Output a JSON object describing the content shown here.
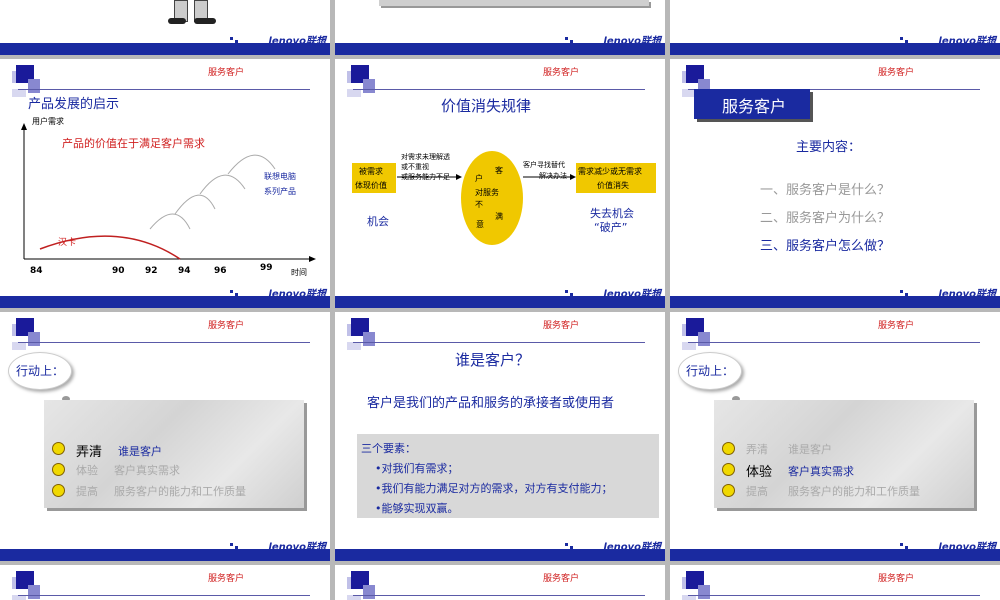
{
  "header": "服务客户",
  "brand": {
    "logo": "lenovo联想"
  },
  "slide4": {
    "title": "产品发展的启示",
    "y_label": "用户需求",
    "note": "产品的价值在于满足客户需求",
    "product_label_1": "联想电脑",
    "product_label_2": "系列产品",
    "han_label": "汉卡",
    "x_label": "时间",
    "ticks": [
      "84",
      "90",
      "92",
      "94",
      "96",
      "99"
    ]
  },
  "slide5": {
    "title": "价值消失规律",
    "box_left_1": "被需求",
    "box_left_2": "体现价值",
    "mid_1": "对需求未理解透",
    "mid_2": "或不重视",
    "mid_3": "或服务能力不足",
    "circle": {
      "c1": "客",
      "c2": "户",
      "c3": "对服务",
      "c4": "不",
      "c5": "满",
      "c6": "意"
    },
    "right_note_1": "客户寻找替代",
    "right_note_2": "解决办法",
    "box_right_1": "需求减少或无需求",
    "box_right_2": "价值消失",
    "left_caption": "机会",
    "right_caption_1": "失去机会",
    "right_caption_2": "“破产”"
  },
  "slide6": {
    "title": "服务客户",
    "subtitle": "主要内容：",
    "items": [
      "一、服务客户是什么？",
      "二、服务客户为什么？",
      "三、服务客户怎么做？"
    ]
  },
  "slide7": {
    "cloud": "行动上：",
    "items": [
      {
        "head": "弄清",
        "tail": "谁是客户"
      },
      {
        "head": "体验",
        "tail": "客户真实需求"
      },
      {
        "head": "提高",
        "tail": "服务客户的能力和工作质量"
      }
    ]
  },
  "slide8": {
    "title": "谁是客户？",
    "definition": "客户是我们的产品和服务的承接者或使用者",
    "box_head": "三个要素：",
    "box_items": [
      "•对我们有需求；",
      "•我们有能力满足对方的需求，对方有支付能力；",
      "•能够实现双赢。"
    ]
  },
  "slide9": {
    "cloud": "行动上：",
    "items": [
      {
        "head": "弄清",
        "tail": "谁是客户"
      },
      {
        "head": "体验",
        "tail": "客户真实需求"
      },
      {
        "head": "提高",
        "tail": "服务客户的能力和工作质量"
      }
    ]
  },
  "colors": {
    "accent": "#1a2aa0",
    "red": "#d02020",
    "yellow": "#f0c800",
    "muted": "#999999"
  }
}
